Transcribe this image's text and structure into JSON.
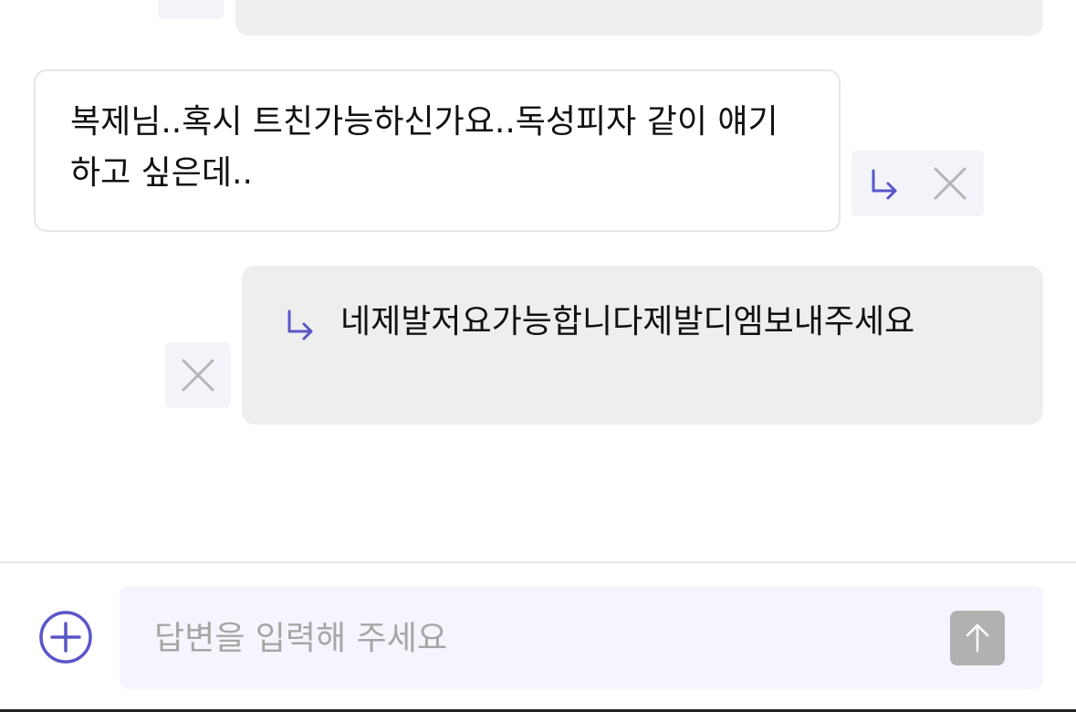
{
  "messages": [
    {
      "text": "복제님..혹시 트친가능하신가요..독성피자 같이 얘기하고 싶은데.."
    },
    {
      "text": "네제발저요가능합니다제발디엠보내주세요"
    }
  ],
  "composer": {
    "placeholder": "답변을 입력해 주세요"
  },
  "colors": {
    "accent": "#5a55c8",
    "muted_icon": "#b5b5b5",
    "send_disabled": "#b1b1b1",
    "incoming_bg": "#ffffff",
    "outgoing_bg": "#eeeeee",
    "action_bg": "#f3f3fa",
    "input_bg": "#f5f5fd"
  },
  "icons": {
    "reply": "reply-arrow-icon",
    "close": "close-icon",
    "add": "plus-circle-icon",
    "send": "arrow-up-icon"
  }
}
